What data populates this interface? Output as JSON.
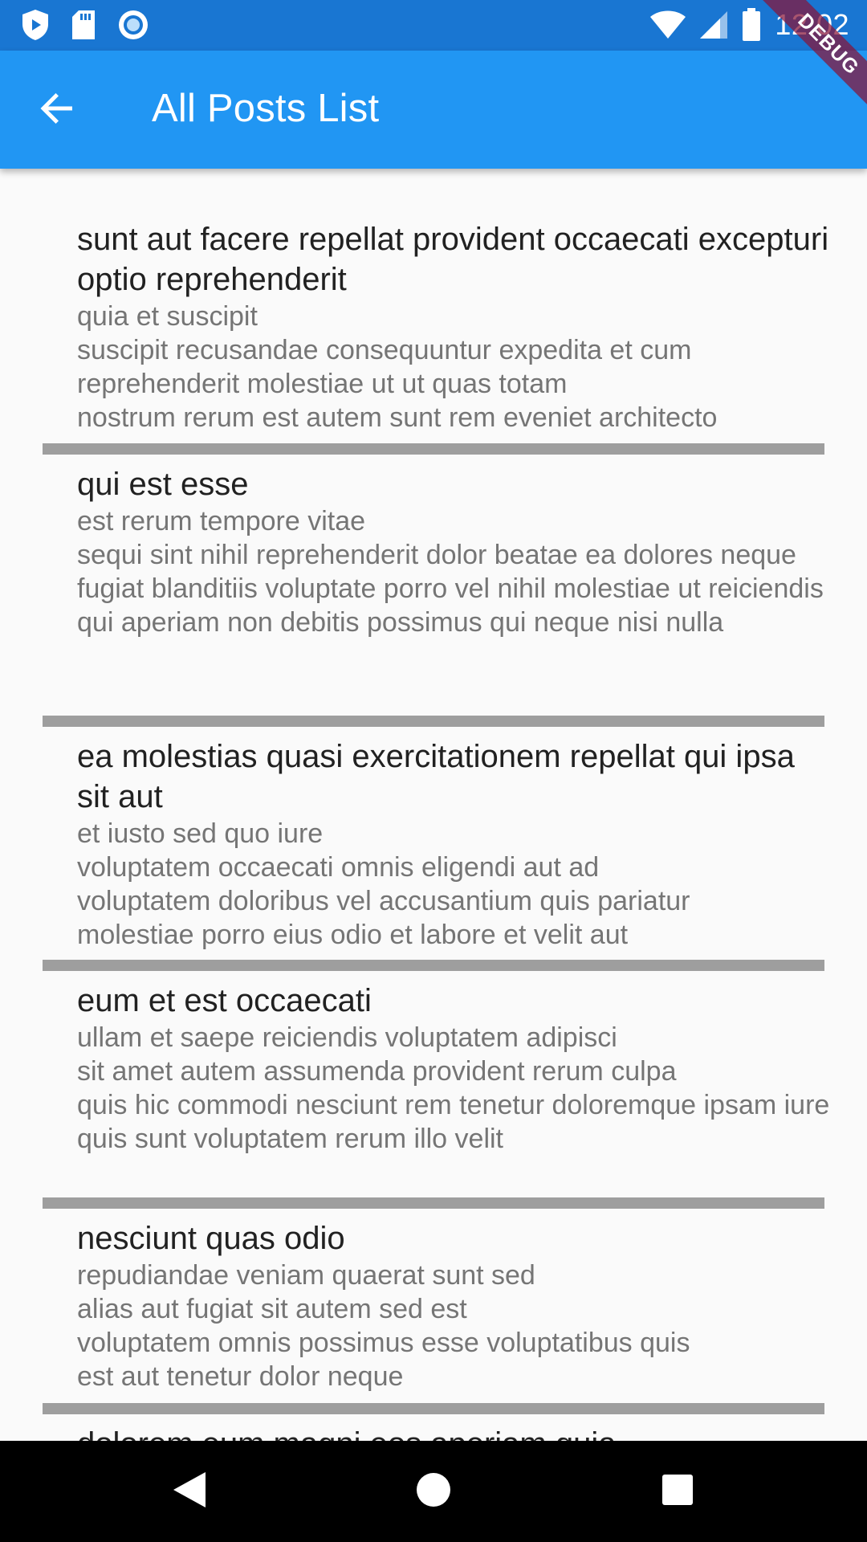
{
  "status_bar": {
    "time": "12:02",
    "left_icons": [
      "shield-play-icon",
      "sd-card-icon",
      "circle-record-icon"
    ],
    "right_icons": [
      "wifi-icon",
      "signal-icon",
      "battery-icon"
    ]
  },
  "app_bar": {
    "title": "All Posts List",
    "back_icon": "arrow-back-icon"
  },
  "debug_banner": "DEBUG",
  "posts": [
    {
      "title": "sunt aut facere repellat provident occaecati excepturi optio reprehenderit",
      "body": "quia et suscipit\nsuscipit recusandae consequuntur expedita et cum reprehenderit molestiae ut ut quas totam\nnostrum rerum est autem sunt rem eveniet architecto"
    },
    {
      "title": "qui est esse",
      "body": "est rerum tempore vitae\nsequi sint nihil reprehenderit dolor beatae ea dolores neque\nfugiat blanditiis voluptate porro vel nihil molestiae ut reiciendis\nqui aperiam non debitis possimus qui neque nisi nulla"
    },
    {
      "title": "ea molestias quasi exercitationem repellat qui ipsa sit aut",
      "body": "et iusto sed quo iure\nvoluptatem occaecati omnis eligendi aut ad\nvoluptatem doloribus vel accusantium quis pariatur\nmolestiae porro eius odio et labore et velit aut"
    },
    {
      "title": "eum et est occaecati",
      "body": "ullam et saepe reiciendis voluptatem adipisci\nsit amet autem assumenda provident rerum culpa\nquis hic commodi nesciunt rem tenetur doloremque ipsam iure\nquis sunt voluptatem rerum illo velit"
    },
    {
      "title": "nesciunt quas odio",
      "body": "repudiandae veniam quaerat sunt sed\nalias aut fugiat sit autem sed est\nvoluptatem omnis possimus esse voluptatibus quis\nest aut tenetur dolor neque"
    },
    {
      "title": "dolorem eum magni eos aperiam quia",
      "body": ""
    }
  ],
  "nav_bar": {
    "icons": [
      "nav-back-icon",
      "nav-home-icon",
      "nav-recents-icon"
    ]
  },
  "colors": {
    "status_bar": "#1976d2",
    "app_bar": "#2196f3",
    "title_text": "#212121",
    "body_text": "#757575",
    "divider": "#9e9e9e",
    "background": "#fafafa"
  }
}
